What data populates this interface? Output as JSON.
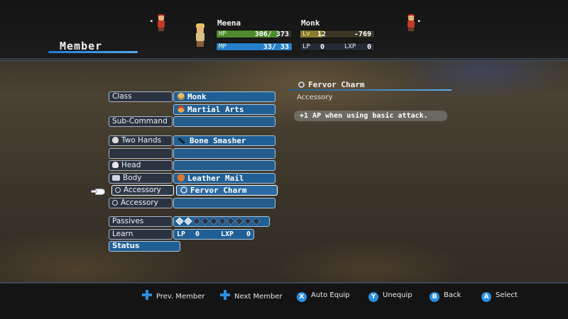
{
  "screen": {
    "title": "Member"
  },
  "character": {
    "name": "Meena",
    "job": "Monk",
    "hp": {
      "label": "HP",
      "current": "306",
      "max": "373",
      "text": "306/ 373",
      "fraction": 0.82
    },
    "mp": {
      "label": "MP",
      "current": "33",
      "max": "33",
      "text": "33/  33",
      "fraction": 1.0
    },
    "lv": {
      "label": "Lv",
      "value": "12",
      "exp_to_next": "-769",
      "fraction": 0.3
    },
    "lp": {
      "label": "LP",
      "value": "0"
    },
    "lxp": {
      "label": "LXP",
      "value": "0"
    }
  },
  "nav": {
    "prev_arrow": "◂",
    "next_arrow": "▸"
  },
  "equipment": {
    "class": {
      "label": "Class",
      "value": "Monk",
      "icon": "monk-face-icon"
    },
    "class_skill": {
      "value": "Martial Arts",
      "icon": "martial-arts-icon"
    },
    "sub_command": {
      "label": "Sub-Command",
      "value": ""
    },
    "two_hands": {
      "label": "Two Hands",
      "value": "Bone Smasher",
      "icon": "staff-icon"
    },
    "blank_row": {
      "label": "",
      "value": ""
    },
    "head": {
      "label": "Head",
      "value": ""
    },
    "body": {
      "label": "Body",
      "value": "Leather Mail",
      "icon": "armor-icon"
    },
    "accessory1": {
      "label": "Accessory",
      "value": "Fervor Charm",
      "icon": "charm-icon",
      "selected": true
    },
    "accessory2": {
      "label": "Accessory",
      "value": ""
    },
    "passives": {
      "label": "Passives",
      "filled": 2,
      "total": 10
    },
    "learn": {
      "label": "Learn",
      "lp_label": "LP",
      "lp_value": "0",
      "lxp_label": "LXP",
      "lxp_value": "0"
    },
    "status": {
      "label": "Status"
    }
  },
  "info": {
    "title": "Fervor Charm",
    "subtitle": "Accessory",
    "effect": "+1 AP when using basic attack."
  },
  "footer": {
    "hints": [
      {
        "glyph": "dpad",
        "label": "Prev. Member"
      },
      {
        "glyph": "dpad",
        "label": "Next Member"
      },
      {
        "glyph": "X",
        "label": "Auto Equip"
      },
      {
        "glyph": "Y",
        "label": "Unequip"
      },
      {
        "glyph": "B",
        "label": "Back"
      },
      {
        "glyph": "A",
        "label": "Select"
      }
    ]
  },
  "colors": {
    "accent": "#2b8fe0",
    "hp": "#4c8a2d",
    "mp": "#2680c9",
    "lv": "#8a7b2c"
  }
}
